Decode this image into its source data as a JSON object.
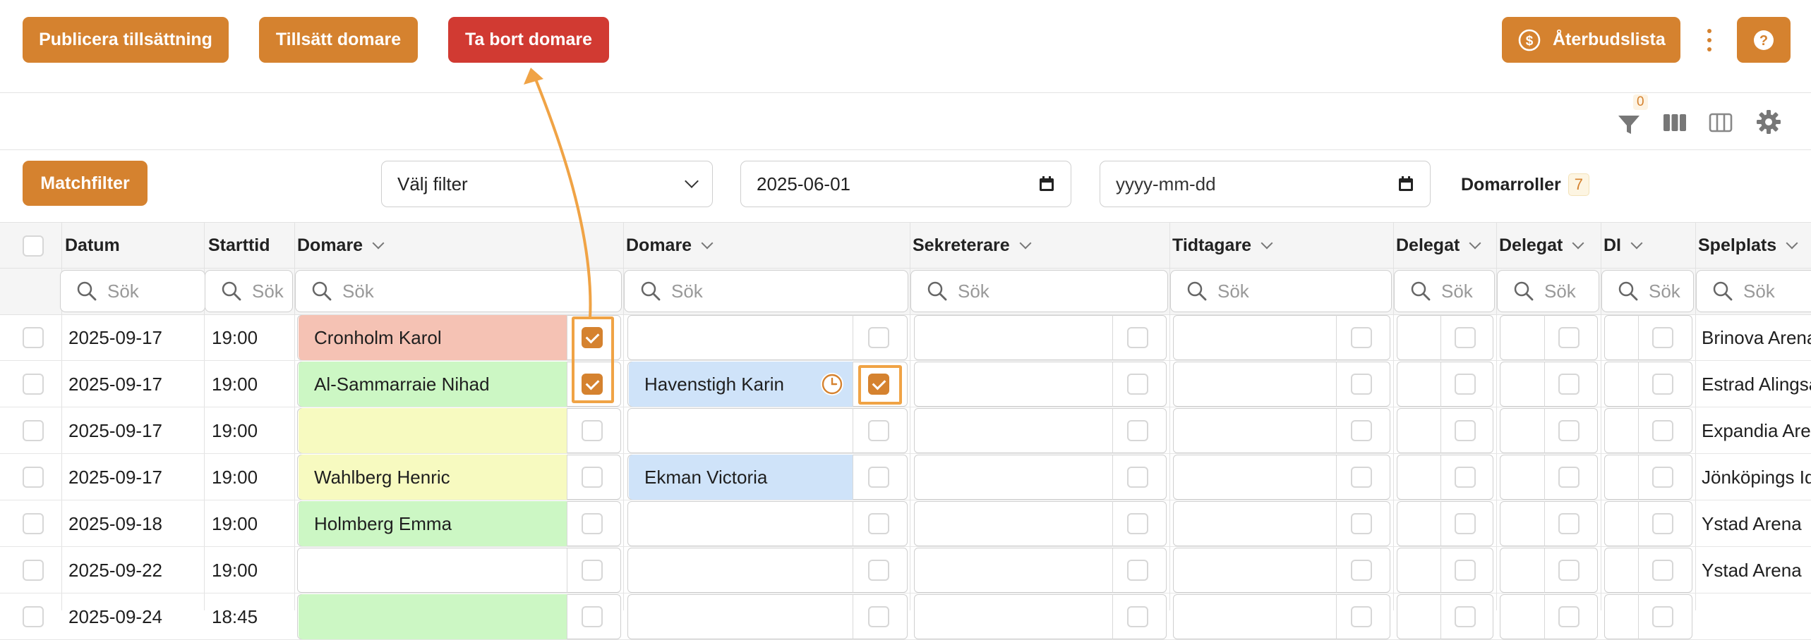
{
  "toolbar": {
    "publish_label": "Publicera tillsättning",
    "assign_label": "Tillsätt domare",
    "remove_label": "Ta bort domare",
    "cancellations_label": "Återbudslista"
  },
  "view_tools": {
    "filter_count": "0"
  },
  "filters": {
    "match_filter_label": "Matchfilter",
    "select_filter_label": "Välj filter",
    "date_from": "2025-06-01",
    "date_to_placeholder": "yyyy-mm-dd",
    "roles_label": "Domarroller",
    "roles_count": "7"
  },
  "table": {
    "search_placeholder": "Sök",
    "columns": [
      "Datum",
      "Starttid",
      "Domare",
      "Domare",
      "Sekreterare",
      "Tidtagare",
      "Delegat",
      "Delegat",
      "DI",
      "Spelplats"
    ],
    "rows": [
      {
        "date": "2025-09-17",
        "time": "19:00",
        "ref1": "Cronholm Karol",
        "ref2": "",
        "venue": "Brinova Arena"
      },
      {
        "date": "2025-09-17",
        "time": "19:00",
        "ref1": "Al-Sammarraie Nihad",
        "ref2": "Havenstigh Karin",
        "venue": "Estrad Alingsås"
      },
      {
        "date": "2025-09-17",
        "time": "19:00",
        "ref1": "",
        "ref2": "",
        "venue": "Expandia Arena"
      },
      {
        "date": "2025-09-17",
        "time": "19:00",
        "ref1": "Wahlberg Henric",
        "ref2": "Ekman Victoria",
        "venue": "Jönköpings Idrottshus"
      },
      {
        "date": "2025-09-18",
        "time": "19:00",
        "ref1": "Holmberg Emma",
        "ref2": "",
        "venue": "Ystad Arena"
      },
      {
        "date": "2025-09-22",
        "time": "19:00",
        "ref1": "",
        "ref2": "",
        "venue": "Ystad Arena"
      },
      {
        "date": "2025-09-24",
        "time": "18:45",
        "ref1": "",
        "ref2": "",
        "venue": ""
      }
    ]
  },
  "colors": {
    "accent": "#d5822f",
    "danger": "#d13a32",
    "declined": "#f5c2b4",
    "confirmed": "#ccf7c4",
    "pending": "#f7fac0",
    "assigned": "#cfe3f9"
  }
}
